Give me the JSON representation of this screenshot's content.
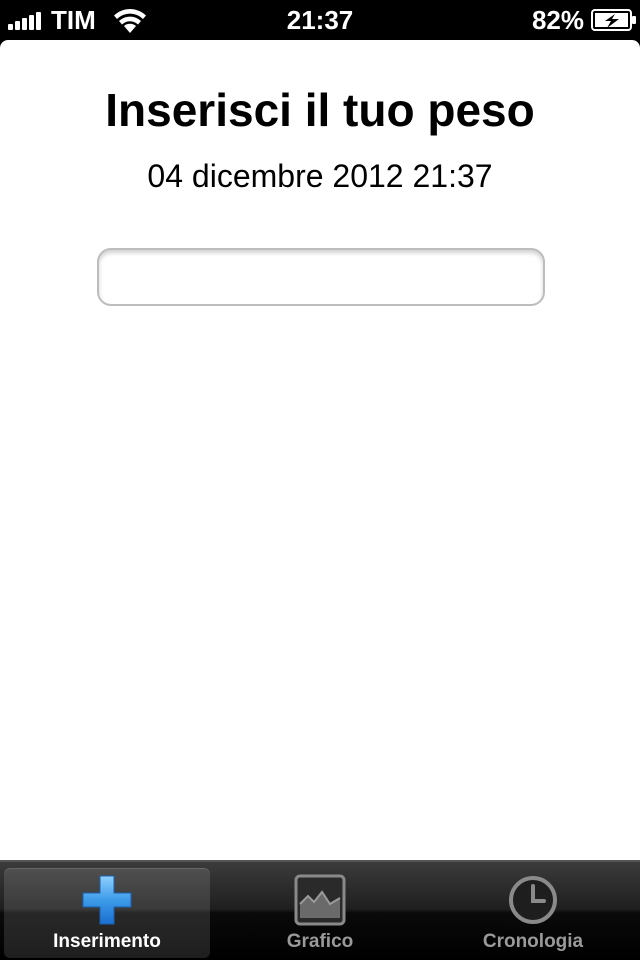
{
  "status_bar": {
    "carrier": "TIM",
    "time": "21:37",
    "battery_percent": "82%",
    "signal_bars": 5,
    "icons": [
      "signal-bars-icon",
      "wifi-icon",
      "battery-charging-icon"
    ]
  },
  "main": {
    "title": "Inserisci il tuo peso",
    "datetime": "04 dicembre 2012 21:37",
    "weight_input": {
      "value": "",
      "placeholder": ""
    }
  },
  "tab_bar": {
    "selected": 0,
    "tabs": [
      {
        "label": "Inserimento",
        "icon": "plus-icon"
      },
      {
        "label": "Grafico",
        "icon": "chart-icon"
      },
      {
        "label": "Cronologia",
        "icon": "clock-icon"
      }
    ]
  },
  "colors": {
    "selected_icon": "#4aa3f0",
    "inactive_label": "#9a9a9a",
    "selected_label": "#ffffff"
  }
}
